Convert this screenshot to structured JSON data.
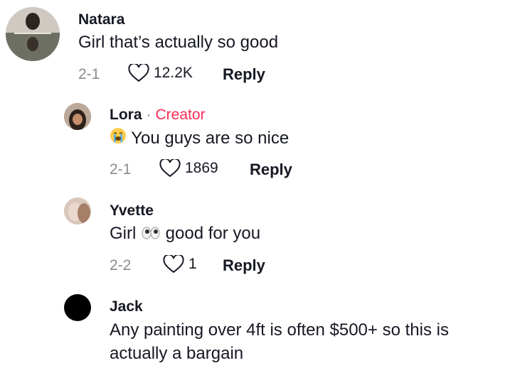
{
  "comments": [
    {
      "name": "Natara",
      "text": "Girl that’s actually so good",
      "date": "2-1",
      "likes": "12.2K",
      "reply": "Reply"
    },
    {
      "name": "Lora",
      "badge": "Creator",
      "text": "You guys are so nice",
      "emoji": "loudly-crying-face",
      "date": "2-1",
      "likes": "1869",
      "reply": "Reply"
    },
    {
      "name": "Yvette",
      "text_before": "Girl",
      "emoji": "eyes",
      "text_after": "good for you",
      "date": "2-2",
      "likes": "1",
      "reply": "Reply"
    },
    {
      "name": "Jack",
      "text_line1": "Any painting over 4ft is often $500+ so this is",
      "text_line2": "actually a bargain"
    }
  ],
  "colors": {
    "text": "#161823",
    "muted": "#8a8b91",
    "creator": "#fe2c55"
  }
}
